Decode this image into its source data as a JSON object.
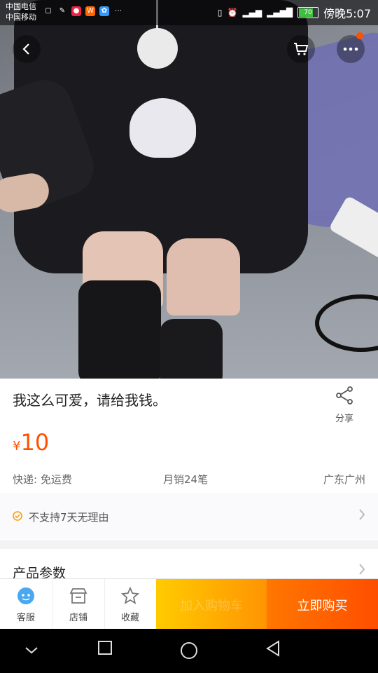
{
  "statusbar": {
    "carrier_1": "中国电信",
    "carrier_2": "中国移动",
    "battery": "70",
    "time": "傍晚5:07"
  },
  "product": {
    "title": "我这么可爱，请给我钱。",
    "currency": "¥",
    "price": "10",
    "shipping": "快递: 免运费",
    "monthly_sales": "月销24笔",
    "location": "广东广州",
    "notice": "不支持7天无理由"
  },
  "share": {
    "label": "分享"
  },
  "params": {
    "label": "产品参数"
  },
  "actionbar": {
    "service": "客服",
    "shop": "店铺",
    "favorite": "收藏",
    "add_to_cart": "加入购物车",
    "buy_now": "立即购买"
  },
  "colors": {
    "accent": "#ff5000",
    "add_cart_start": "#ffcb00",
    "buy_now": "#ff4e00"
  },
  "icons": [
    "back-icon",
    "cart-icon",
    "more-icon",
    "share-icon",
    "check-circle-icon",
    "chevron-right-icon",
    "service-icon",
    "shop-icon",
    "star-icon",
    "nav-down-icon",
    "nav-recent-icon",
    "nav-home-icon",
    "nav-back-icon"
  ]
}
